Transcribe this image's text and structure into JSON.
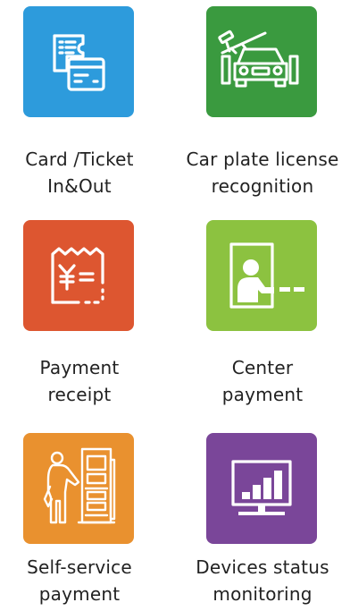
{
  "features": [
    {
      "id": "card-ticket",
      "icon": "card-ticket-icon",
      "color": "#2D9BDC",
      "label_line1": "Card /Ticket",
      "label_line2": "In&Out"
    },
    {
      "id": "plate-recognition",
      "icon": "car-barrier-camera-icon",
      "color": "#3A9A3F",
      "label_line1": "Car plate license",
      "label_line2": "recognition"
    },
    {
      "id": "payment-receipt",
      "icon": "yen-receipt-icon",
      "color": "#DD5630",
      "label_line1": "Payment",
      "label_line2": "receipt"
    },
    {
      "id": "center-payment",
      "icon": "cashier-window-icon",
      "color": "#8CC240",
      "label_line1": "Center",
      "label_line2": "payment"
    },
    {
      "id": "self-service",
      "icon": "self-service-kiosk-icon",
      "color": "#E9912F",
      "label_line1": "Self-service",
      "label_line2": "payment"
    },
    {
      "id": "devices-monitoring",
      "icon": "monitor-bar-chart-icon",
      "color": "#7A4699",
      "label_line1": "Devices status",
      "label_line2": "monitoring"
    }
  ]
}
